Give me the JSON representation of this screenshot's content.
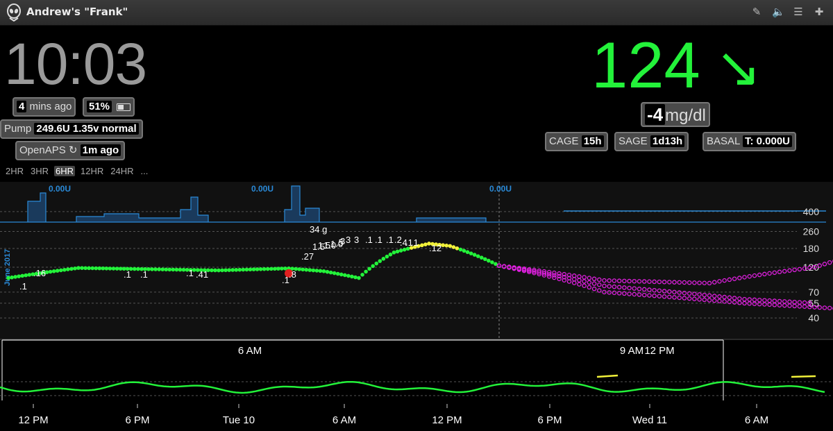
{
  "window": {
    "title": "Andrew's \"Frank\""
  },
  "toolbar": {
    "icons": [
      "edit-icon",
      "volume-icon",
      "menu-icon",
      "plus-icon"
    ]
  },
  "clock": "10:03",
  "status": {
    "mins_ago_value": "4",
    "mins_ago_label": "mins ago",
    "battery": "51%",
    "pump_label": "Pump",
    "pump_value": "249.6U 1.35v normal",
    "openaps_label": "OpenAPS",
    "openaps_value": "1m ago"
  },
  "time_ranges": [
    "2HR",
    "3HR",
    "6HR",
    "12HR",
    "24HR",
    "..."
  ],
  "active_range": "6HR",
  "bg": {
    "value": "124",
    "arrow": "↘",
    "delta_value": "-4",
    "delta_unit": "mg/dl"
  },
  "pills": {
    "cage_label": "CAGE",
    "cage_value": "15h",
    "sage_label": "SAGE",
    "sage_value": "1d13h",
    "basal_label": "BASAL",
    "basal_value": "T: 0.000U"
  },
  "colors": {
    "in_range": "#23f23a",
    "high": "#f2f23a",
    "prediction": "#e020e0",
    "basal": "#2a8ad8",
    "carb": "#e02020"
  },
  "chart_data": {
    "type": "scatter",
    "y_ticks": [
      400,
      260,
      180,
      120,
      70,
      55,
      40
    ],
    "y_axis": "log",
    "ylim": [
      35,
      450
    ],
    "basal_labels": [
      "0.00U",
      "0.00U",
      "0.00U"
    ],
    "side_label": "June 2017",
    "annotations": [
      ".1",
      ".16",
      ".1",
      ".1",
      ".1",
      ".41",
      ".1",
      ".8",
      ".27",
      "34 g",
      "1.5",
      "1.5",
      "1.0",
      "1.0",
      ".5",
      "3",
      "3",
      "3",
      ".1",
      ".1",
      ".1",
      ".2",
      ".4",
      ".1",
      ".1",
      ".12"
    ],
    "main_x": [
      0.0,
      1.0,
      2.0,
      3.0,
      4.0,
      4.5,
      5.0,
      5.5,
      6.0,
      6.3,
      7.0
    ],
    "main_y": [
      95,
      118,
      115,
      112,
      117,
      110,
      95,
      165,
      200,
      190,
      124
    ],
    "predictions": [
      {
        "x": [
          7.0,
          8.5,
          10.0,
          11.5,
          12.5
        ],
        "y": [
          124,
          90,
          85,
          120,
          180
        ]
      },
      {
        "x": [
          7.0,
          8.5,
          10.5,
          11.5
        ],
        "y": [
          124,
          80,
          60,
          55
        ]
      },
      {
        "x": [
          7.0,
          8.5,
          10.5,
          12.5
        ],
        "y": [
          124,
          70,
          55,
          46
        ]
      }
    ],
    "overview_x_ticks": [
      "6 AM",
      "9 AM",
      "12 PM"
    ],
    "bottom_x_ticks": [
      "12 PM",
      "6 PM",
      "Tue 10",
      "6 AM",
      "12 PM",
      "6 PM",
      "Wed 11",
      "6 AM"
    ]
  }
}
